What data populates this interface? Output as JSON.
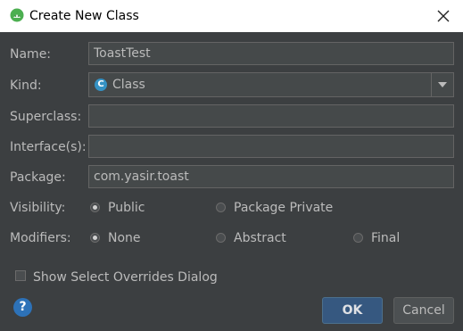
{
  "window": {
    "title": "Create New Class"
  },
  "form": {
    "name_label": "Name:",
    "name_value": "ToastTest",
    "kind_label": "Kind:",
    "kind_value": "Class",
    "kind_icon_letter": "C",
    "superclass_label": "Superclass:",
    "superclass_value": "",
    "interfaces_label": "Interface(s):",
    "interfaces_value": "",
    "package_label": "Package:",
    "package_value": "com.yasir.toast",
    "visibility_label": "Visibility:",
    "visibility_options": [
      "Public",
      "Package Private"
    ],
    "visibility_selected": "Public",
    "modifiers_label": "Modifiers:",
    "modifiers_options": [
      "None",
      "Abstract",
      "Final"
    ],
    "modifiers_selected": "None",
    "show_overrides_label": "Show Select Overrides Dialog",
    "show_overrides_checked": false
  },
  "buttons": {
    "help": "?",
    "ok": "OK",
    "cancel": "Cancel"
  },
  "colors": {
    "background": "#3c3f41",
    "field": "#45494a",
    "ok_button": "#365880",
    "help_icon": "#2d72b8",
    "class_icon": "#3592c4"
  },
  "icons": {
    "app": "android-studio-icon",
    "close": "close-icon",
    "kind": "class-icon",
    "dropdown": "chevron-down-icon",
    "help": "help-icon"
  }
}
